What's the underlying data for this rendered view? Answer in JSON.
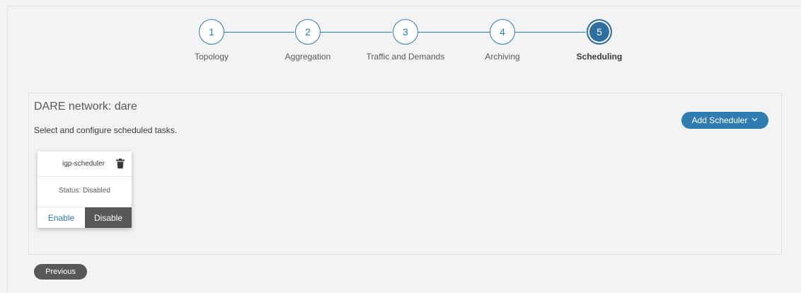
{
  "wizard": {
    "steps": [
      {
        "number": "1",
        "label": "Topology"
      },
      {
        "number": "2",
        "label": "Aggregation"
      },
      {
        "number": "3",
        "label": "Traffic and Demands"
      },
      {
        "number": "4",
        "label": "Archiving"
      },
      {
        "number": "5",
        "label": "Scheduling"
      }
    ],
    "active_step": 5
  },
  "main": {
    "title": "DARE network: dare",
    "subtitle": "Select and configure scheduled tasks.",
    "add_scheduler_label": "Add Scheduler",
    "scheduler": {
      "name": "igp-scheduler",
      "status": "Status: Disabled",
      "enable_label": "Enable",
      "disable_label": "Disable"
    }
  },
  "footer": {
    "previous_label": "Previous"
  },
  "colors": {
    "accent": "#2f7cb0",
    "active_step": "#2f6f9f",
    "dark_button": "#58585b",
    "background": "#f2f3f4"
  },
  "icons": {
    "trash": "trash-icon",
    "dropdown": "chevron-down-icon"
  }
}
